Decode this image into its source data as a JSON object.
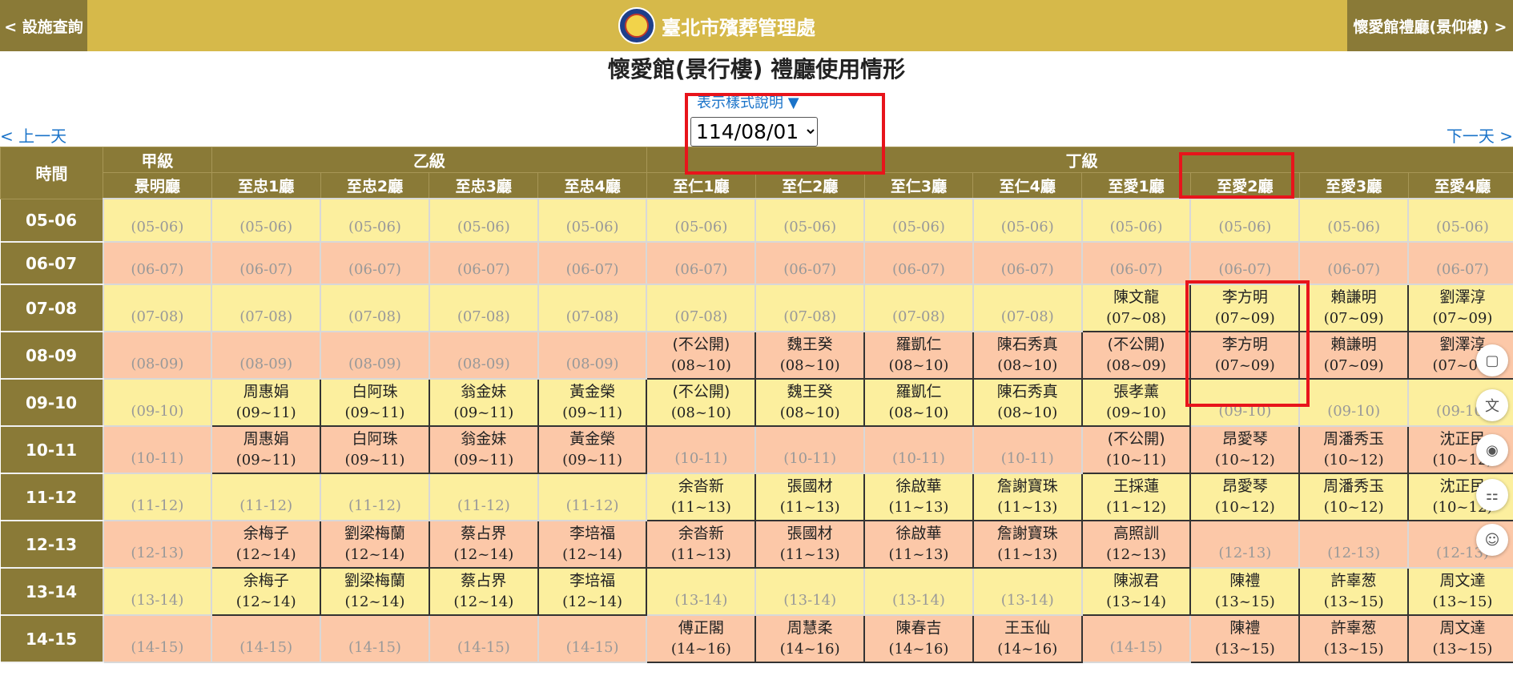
{
  "header": {
    "left_nav": "< 設施查詢",
    "brand": "臺北市殯葬管理處",
    "right_nav": "懷愛館禮廳(景仰樓) >"
  },
  "page_title": "懷愛館(景行樓) 禮廳使用情形",
  "legend_link": "表示樣式說明 ▼",
  "date_select": {
    "value": "114/08/01",
    "options": [
      "114/08/01"
    ]
  },
  "prev_day": "< 上一天",
  "next_day": "下一天 >",
  "colors": {
    "header_gold": "#d6b94a",
    "header_dark": "#8a7a37",
    "row_odd": "#fcef9e",
    "row_even": "#fcc8a8",
    "highlight_red": "#e8141b",
    "link_blue": "#1a73c9"
  },
  "table": {
    "time_header": "時間",
    "groups": [
      {
        "label": "甲級",
        "span": 1
      },
      {
        "label": "乙級",
        "span": 4
      },
      {
        "label": "丁級",
        "span": 8
      }
    ],
    "halls": [
      "景明廳",
      "至忠1廳",
      "至忠2廳",
      "至忠3廳",
      "至忠4廳",
      "至仁1廳",
      "至仁2廳",
      "至仁3廳",
      "至仁4廳",
      "至愛1廳",
      "至愛2廳",
      "至愛3廳",
      "至愛4廳"
    ],
    "rows": [
      {
        "time": "05-06",
        "cells": [
          "(05-06)",
          "(05-06)",
          "(05-06)",
          "(05-06)",
          "(05-06)",
          "(05-06)",
          "(05-06)",
          "(05-06)",
          "(05-06)",
          "(05-06)",
          "(05-06)",
          "(05-06)",
          "(05-06)"
        ]
      },
      {
        "time": "06-07",
        "cells": [
          "(06-07)",
          "(06-07)",
          "(06-07)",
          "(06-07)",
          "(06-07)",
          "(06-07)",
          "(06-07)",
          "(06-07)",
          "(06-07)",
          "(06-07)",
          "(06-07)",
          "(06-07)",
          "(06-07)"
        ]
      },
      {
        "time": "07-08",
        "cells": [
          "(07-08)",
          "(07-08)",
          "(07-08)",
          "(07-08)",
          "(07-08)",
          "(07-08)",
          "(07-08)",
          "(07-08)",
          "(07-08)",
          {
            "name": "陳文龍",
            "time": "(07~08)"
          },
          {
            "name": "李方明",
            "time": "(07~09)"
          },
          {
            "name": "賴謙明",
            "time": "(07~09)"
          },
          {
            "name": "劉澤淳",
            "time": "(07~09)"
          }
        ]
      },
      {
        "time": "08-09",
        "cells": [
          "(08-09)",
          "(08-09)",
          "(08-09)",
          "(08-09)",
          "(08-09)",
          {
            "name": "(不公開)",
            "time": "(08~10)"
          },
          {
            "name": "魏王癸",
            "time": "(08~10)"
          },
          {
            "name": "羅凱仁",
            "time": "(08~10)"
          },
          {
            "name": "陳石秀真",
            "time": "(08~10)"
          },
          {
            "name": "(不公開)",
            "time": "(08~09)"
          },
          {
            "name": "李方明",
            "time": "(07~09)"
          },
          {
            "name": "賴謙明",
            "time": "(07~09)"
          },
          {
            "name": "劉澤淳",
            "time": "(07~09)"
          }
        ]
      },
      {
        "time": "09-10",
        "cells": [
          "(09-10)",
          {
            "name": "周惠娟",
            "time": "(09~11)"
          },
          {
            "name": "白阿珠",
            "time": "(09~11)"
          },
          {
            "name": "翁金妹",
            "time": "(09~11)"
          },
          {
            "name": "黃金榮",
            "time": "(09~11)"
          },
          {
            "name": "(不公開)",
            "time": "(08~10)"
          },
          {
            "name": "魏王癸",
            "time": "(08~10)"
          },
          {
            "name": "羅凱仁",
            "time": "(08~10)"
          },
          {
            "name": "陳石秀真",
            "time": "(08~10)"
          },
          {
            "name": "張孝薰",
            "time": "(09~10)"
          },
          "(09-10)",
          "(09-10)",
          "(09-10)"
        ]
      },
      {
        "time": "10-11",
        "cells": [
          "(10-11)",
          {
            "name": "周惠娟",
            "time": "(09~11)"
          },
          {
            "name": "白阿珠",
            "time": "(09~11)"
          },
          {
            "name": "翁金妹",
            "time": "(09~11)"
          },
          {
            "name": "黃金榮",
            "time": "(09~11)"
          },
          "(10-11)",
          "(10-11)",
          "(10-11)",
          "(10-11)",
          {
            "name": "(不公開)",
            "time": "(10~11)"
          },
          {
            "name": "昂愛琴",
            "time": "(10~12)"
          },
          {
            "name": "周潘秀玉",
            "time": "(10~12)"
          },
          {
            "name": "沈正民",
            "time": "(10~12)"
          }
        ]
      },
      {
        "time": "11-12",
        "cells": [
          "(11-12)",
          "(11-12)",
          "(11-12)",
          "(11-12)",
          "(11-12)",
          {
            "name": "余沓新",
            "time": "(11~13)"
          },
          {
            "name": "張國材",
            "time": "(11~13)"
          },
          {
            "name": "徐啟華",
            "time": "(11~13)"
          },
          {
            "name": "詹謝寶珠",
            "time": "(11~13)"
          },
          {
            "name": "王採蓮",
            "time": "(11~12)"
          },
          {
            "name": "昂愛琴",
            "time": "(10~12)"
          },
          {
            "name": "周潘秀玉",
            "time": "(10~12)"
          },
          {
            "name": "沈正民",
            "time": "(10~12)"
          }
        ]
      },
      {
        "time": "12-13",
        "cells": [
          "(12-13)",
          {
            "name": "余梅子",
            "time": "(12~14)"
          },
          {
            "name": "劉梁梅蘭",
            "time": "(12~14)"
          },
          {
            "name": "蔡占界",
            "time": "(12~14)"
          },
          {
            "name": "李培福",
            "time": "(12~14)"
          },
          {
            "name": "余沓新",
            "time": "(11~13)"
          },
          {
            "name": "張國材",
            "time": "(11~13)"
          },
          {
            "name": "徐啟華",
            "time": "(11~13)"
          },
          {
            "name": "詹謝寶珠",
            "time": "(11~13)"
          },
          {
            "name": "高照訓",
            "time": "(12~13)"
          },
          "(12-13)",
          "(12-13)",
          "(12-13)"
        ]
      },
      {
        "time": "13-14",
        "cells": [
          "(13-14)",
          {
            "name": "余梅子",
            "time": "(12~14)"
          },
          {
            "name": "劉梁梅蘭",
            "time": "(12~14)"
          },
          {
            "name": "蔡占界",
            "time": "(12~14)"
          },
          {
            "name": "李培福",
            "time": "(12~14)"
          },
          "(13-14)",
          "(13-14)",
          "(13-14)",
          "(13-14)",
          {
            "name": "陳淑君",
            "time": "(13~14)"
          },
          {
            "name": "陳禮",
            "time": "(13~15)"
          },
          {
            "name": "許辜葱",
            "time": "(13~15)"
          },
          {
            "name": "周文達",
            "time": "(13~15)"
          }
        ]
      },
      {
        "time": "14-15",
        "cells": [
          "(14-15)",
          "(14-15)",
          "(14-15)",
          "(14-15)",
          "(14-15)",
          {
            "name": "傅正閣",
            "time": "(14~16)"
          },
          {
            "name": "周慧柔",
            "time": "(14~16)"
          },
          {
            "name": "陳春吉",
            "time": "(14~16)"
          },
          {
            "name": "王玉仙",
            "time": "(14~16)"
          },
          "(14-15)",
          {
            "name": "陳禮",
            "time": "(13~15)"
          },
          {
            "name": "許辜葱",
            "time": "(13~15)"
          },
          {
            "name": "周文達",
            "time": "(13~15)"
          }
        ]
      }
    ]
  },
  "side_tools": [
    {
      "icon": "book-icon",
      "glyph": "▢"
    },
    {
      "icon": "translate-icon",
      "glyph": "文"
    },
    {
      "icon": "podcast-icon",
      "glyph": "◉"
    },
    {
      "icon": "apps-icon",
      "glyph": "⚏"
    },
    {
      "icon": "assistant-icon",
      "glyph": "☺"
    }
  ]
}
